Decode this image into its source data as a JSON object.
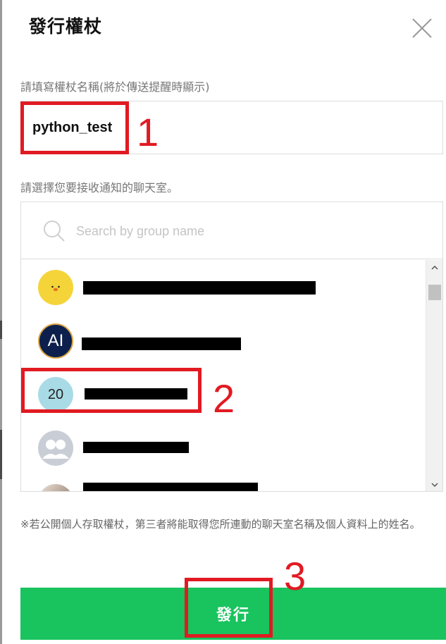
{
  "dialog": {
    "title": "發行權杖",
    "close_icon": "close-x-icon"
  },
  "token_name": {
    "label": "請填寫權杖名稱(將於傳送提醒時顯示)",
    "value": "python_test"
  },
  "chat_select": {
    "label": "請選擇您要接收通知的聊天室。",
    "search_placeholder": "Search by group name",
    "items": [
      {
        "avatar": "sally-chick-icon",
        "avatar_text": "",
        "name": "[redacted]"
      },
      {
        "avatar": "ai-logo",
        "avatar_text": "AI",
        "name": "[redacted]"
      },
      {
        "avatar": "group-20",
        "avatar_text": "20",
        "name": "[redacted]"
      },
      {
        "avatar": "default-group-icon",
        "avatar_text": "",
        "name": "[redacted]"
      },
      {
        "avatar": "photo",
        "avatar_text": "",
        "name": "[redacted]"
      }
    ]
  },
  "disclaimer": "※若公開個人存取權杖，第三者將能取得您所連動的聊天室名稱及個人資料上的姓名。",
  "submit_label": "發行",
  "annotations": {
    "step1": "1",
    "step2": "2",
    "step3": "3"
  },
  "colors": {
    "accent_green": "#19c35e",
    "annotation_red": "#e11a22",
    "ai_avatar_bg": "#0d1f4c",
    "sally_avatar_bg": "#f5d43a",
    "group20_avatar_bg": "#a9dbe6"
  }
}
